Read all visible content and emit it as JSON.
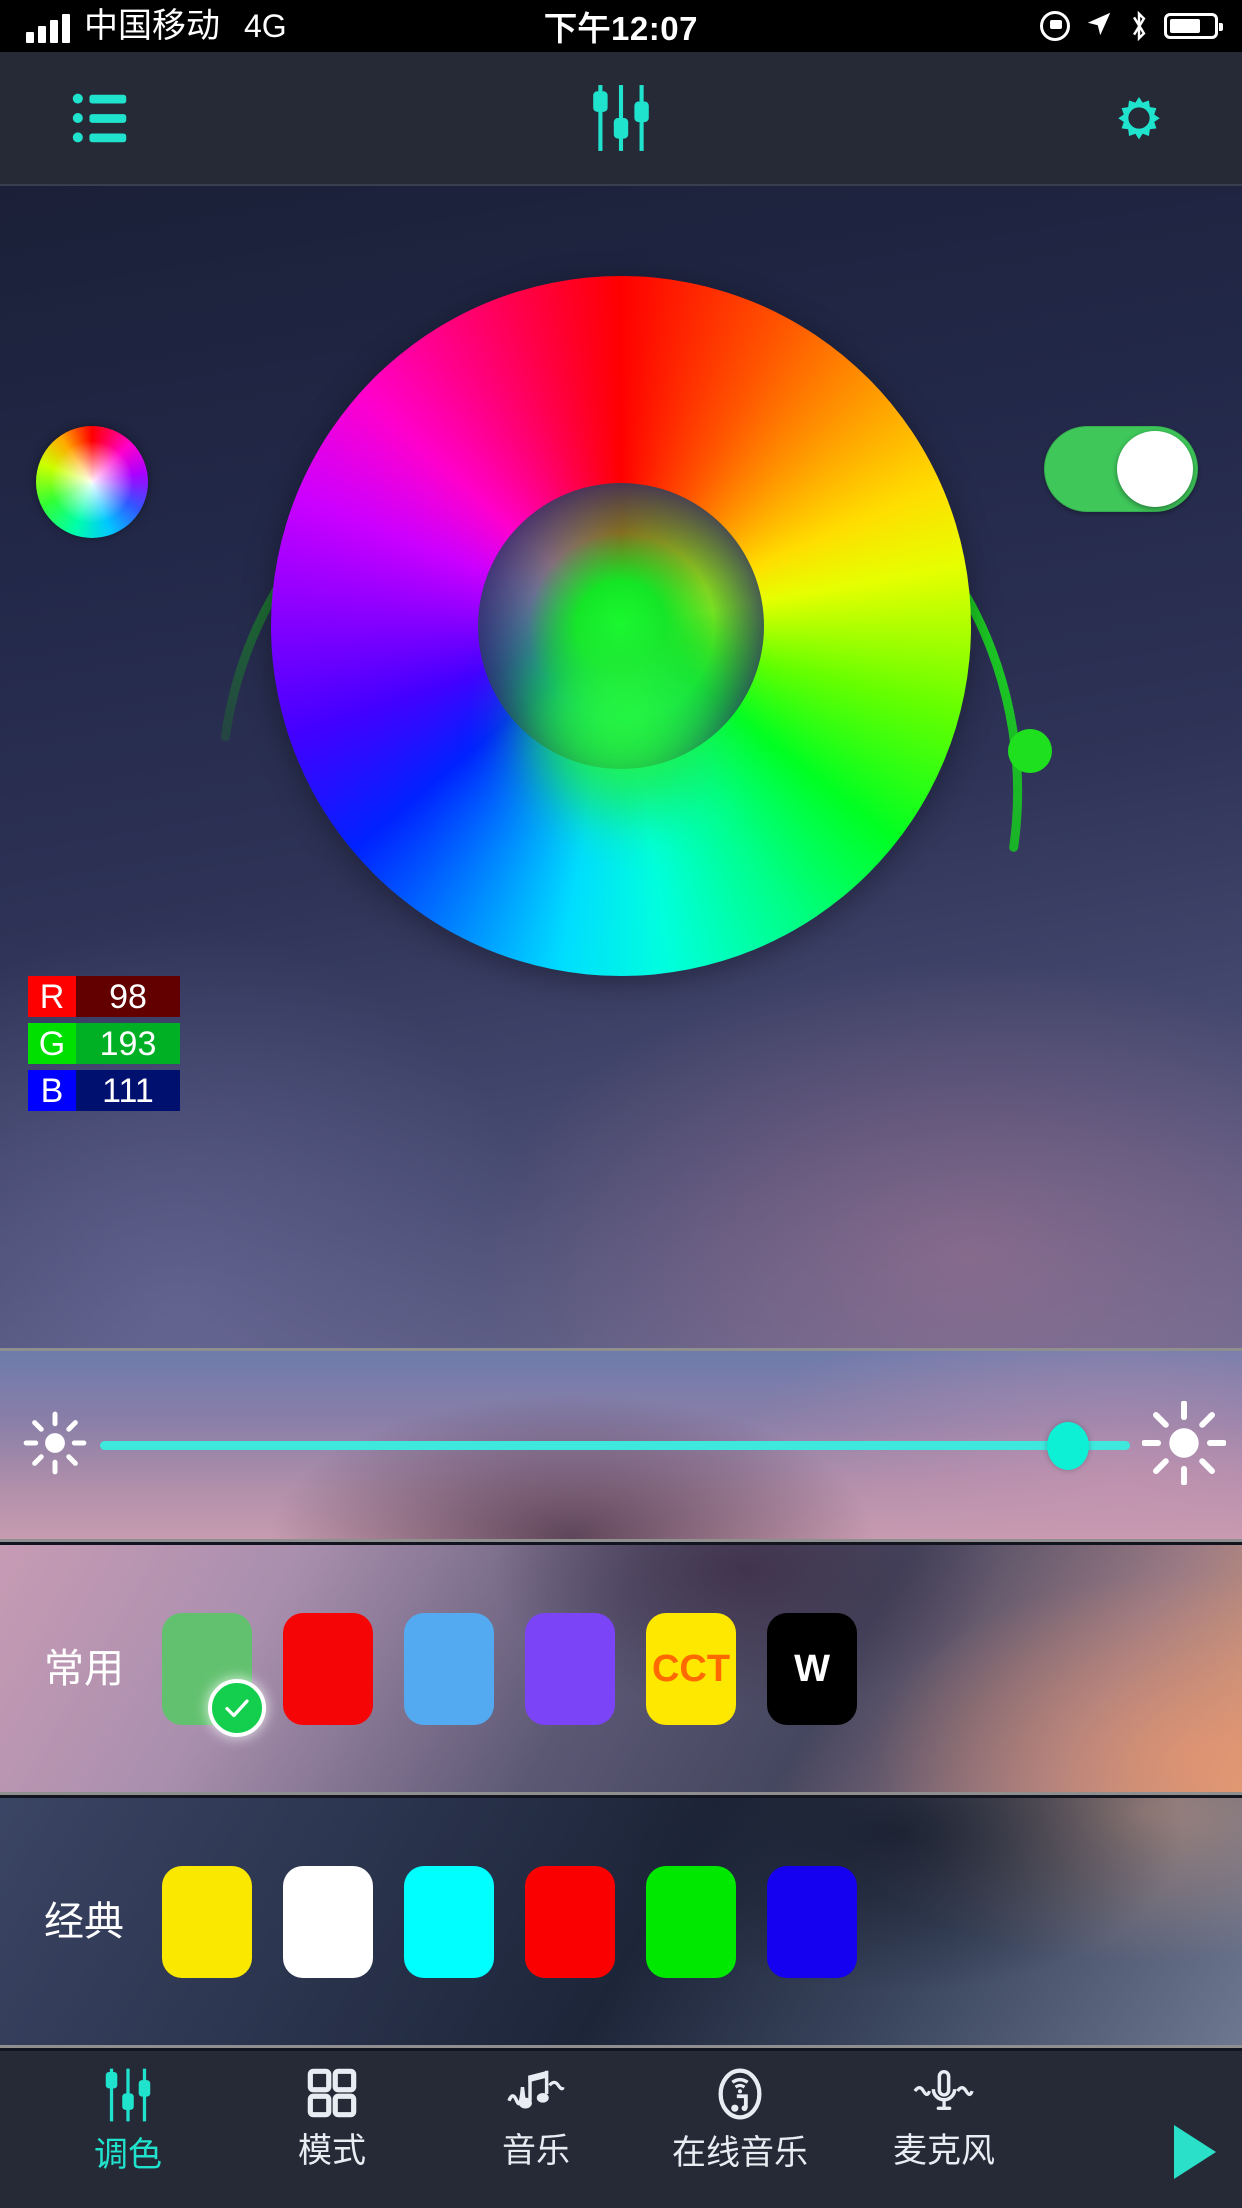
{
  "statusbar": {
    "carrier": "中国移动",
    "network": "4G",
    "time": "下午12:07",
    "icons": [
      "rotation-lock-icon",
      "location-arrow-icon",
      "bluetooth-icon",
      "battery-icon"
    ],
    "battery_level": 72
  },
  "topnav": {
    "left_label": "list-icon",
    "center_label": "sliders-icon",
    "right_label": "gear-icon",
    "accent": "#20e3cd"
  },
  "stage": {
    "wheel_button": "color-wheel-icon",
    "power_toggle_on": true,
    "power_toggle_color": "#3fc75a",
    "selected_color_hex": "#62c16f",
    "arc_color": "#1fd81f",
    "arc_value_deg": 268
  },
  "rgb": {
    "rows": [
      {
        "key": "R",
        "value": "98",
        "key_bg": "#ff0000",
        "val_bg": "#620000"
      },
      {
        "key": "G",
        "value": "193",
        "key_bg": "#00e000",
        "val_bg": "#00b024"
      },
      {
        "key": "B",
        "value": "111",
        "key_bg": "#0000ff",
        "val_bg": "#00106f"
      }
    ]
  },
  "brightness": {
    "left_icon": "sun-small-icon",
    "right_icon": "sun-large-icon",
    "value": 94,
    "track_color": "#3fe8dc",
    "knob_color": "#0df0d5"
  },
  "presets": [
    {
      "label": "常用",
      "name": "common-colors",
      "swatches": [
        {
          "name": "swatch-green",
          "color": "#62c16f",
          "text": "",
          "text_color": "",
          "selected": true
        },
        {
          "name": "swatch-red",
          "color": "#f50505",
          "text": "",
          "text_color": "",
          "selected": false
        },
        {
          "name": "swatch-lightblue",
          "color": "#54aaf0",
          "text": "",
          "text_color": "",
          "selected": false
        },
        {
          "name": "swatch-purple",
          "color": "#7b44f7",
          "text": "",
          "text_color": "",
          "selected": false
        },
        {
          "name": "swatch-cct",
          "color": "#ffe800",
          "text": "CCT",
          "text_color": "#ff6a00",
          "selected": false
        },
        {
          "name": "swatch-white-led",
          "color": "#000000",
          "text": "W",
          "text_color": "#ffffff",
          "selected": false
        }
      ]
    },
    {
      "label": "经典",
      "name": "classic-colors",
      "swatches": [
        {
          "name": "swatch-yellow",
          "color": "#fbe800",
          "text": "",
          "text_color": "",
          "selected": false
        },
        {
          "name": "swatch-white",
          "color": "#ffffff",
          "text": "",
          "text_color": "",
          "selected": false
        },
        {
          "name": "swatch-cyan",
          "color": "#00ffff",
          "text": "",
          "text_color": "",
          "selected": false
        },
        {
          "name": "swatch-red2",
          "color": "#fa0000",
          "text": "",
          "text_color": "",
          "selected": false
        },
        {
          "name": "swatch-green2",
          "color": "#00e800",
          "text": "",
          "text_color": "",
          "selected": false
        },
        {
          "name": "swatch-blue",
          "color": "#1500f0",
          "text": "",
          "text_color": "",
          "selected": false
        }
      ]
    }
  ],
  "tabbar": {
    "items": [
      {
        "label": "调色",
        "icon": "sliders-icon",
        "active": true
      },
      {
        "label": "模式",
        "icon": "grid-icon",
        "active": false
      },
      {
        "label": "音乐",
        "icon": "music-note-icon",
        "active": false
      },
      {
        "label": "在线音乐",
        "icon": "online-music-icon",
        "active": false
      },
      {
        "label": "麦克风",
        "icon": "microphone-icon",
        "active": false
      }
    ],
    "play_button": "play-icon",
    "active_color": "#20e3cd"
  }
}
